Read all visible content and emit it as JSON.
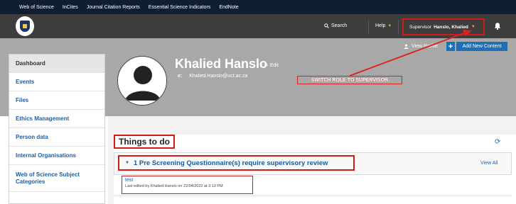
{
  "toplinks": [
    "Web of Science",
    "InCites",
    "Journal Citation Reports",
    "Essential Science Indicators",
    "EndNote"
  ],
  "header": {
    "search_label": "Search",
    "help_label": "Help",
    "supervisor_prefix": "Supervisor",
    "supervisor_name": "Hanslo, Khalied",
    "icons": {
      "search": "search-icon",
      "bell": "bell-icon",
      "logo": "university-crest-icon"
    }
  },
  "profile": {
    "view_profile_label": "View Profile",
    "add_new_label": "Add New Content",
    "name": "Khalied Hanslo",
    "edit_label": "Edit",
    "email_label": "e:",
    "email": "Khalied.Hanslo@uct.ac.za"
  },
  "annotation": {
    "label": "SWITCH ROLE TO SUPERVISOR",
    "color": "#e0201c"
  },
  "sidebar": {
    "items": [
      {
        "label": "Dashboard"
      },
      {
        "label": "Events"
      },
      {
        "label": "Files"
      },
      {
        "label": "Ethics Management"
      },
      {
        "label": "Person data"
      },
      {
        "label": "Internal Organisations"
      },
      {
        "label": "Web of Science Subject Categories"
      }
    ]
  },
  "main": {
    "things_to_do": "Things to do",
    "review_title": "1 Pre Screening Questionnaire(s) require supervisory review",
    "view_all": "View All",
    "task_name": "test",
    "task_meta": "Last edited by Khalied Hanslo on 22/04/2022 at 3:13 PM"
  },
  "colors": {
    "nav_dark": "#0f1e33",
    "header_grey": "#3d3d3d",
    "banner_grey": "#a8a8a8",
    "accent_blue": "#1d6fb8",
    "highlight_red": "#d11a1a",
    "help_caret": "#f5a623"
  }
}
